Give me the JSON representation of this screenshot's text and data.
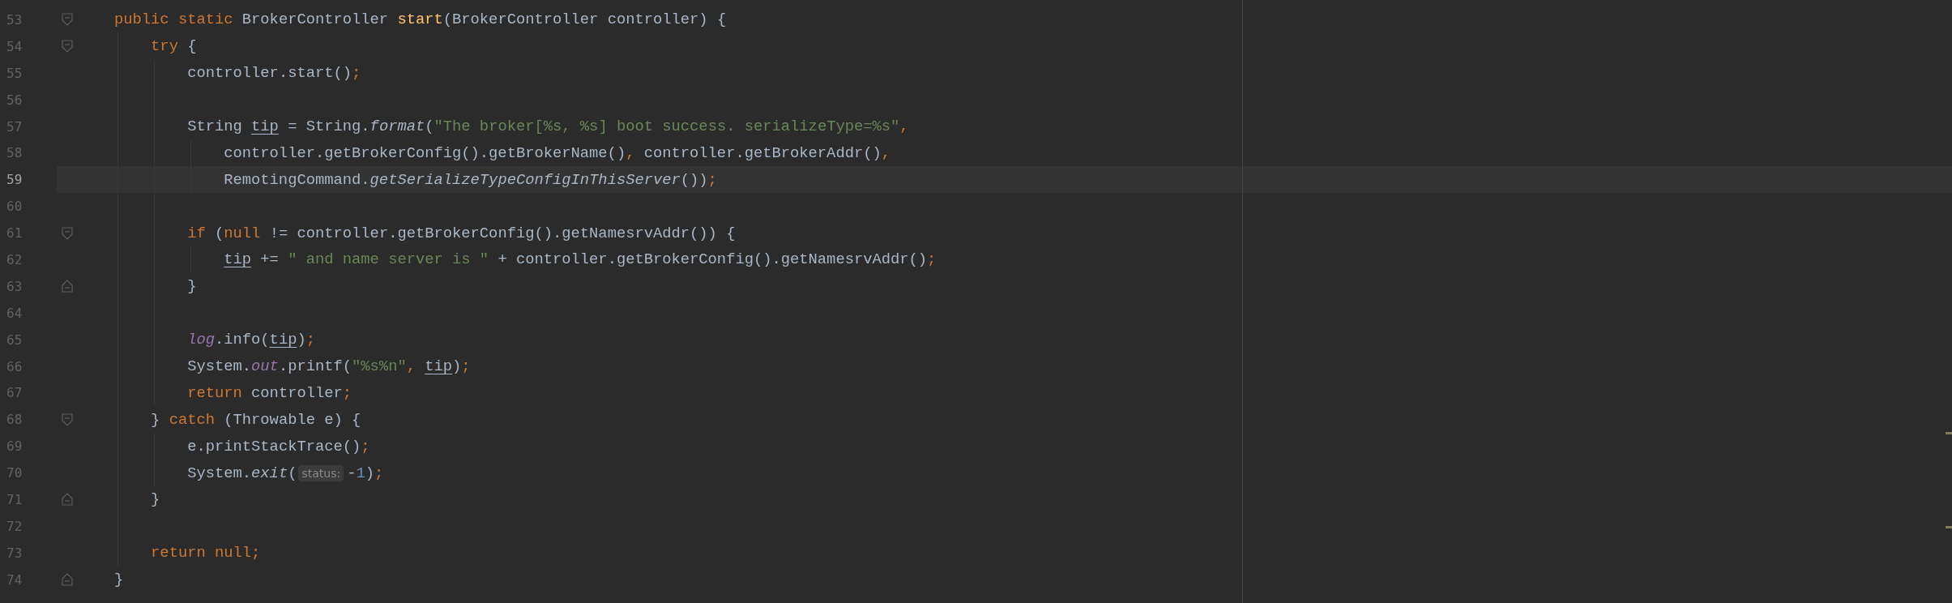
{
  "editor": {
    "lines": [
      {
        "number": "53",
        "current": false,
        "fold_start": true,
        "fold_end": false,
        "tokens": [
          {
            "kind": "keyword",
            "text": "    public static"
          },
          {
            "kind": "text",
            "text": " BrokerController "
          },
          {
            "kind": "declaration",
            "text": "start"
          },
          {
            "kind": "text",
            "text": "(BrokerController controller) {"
          }
        ]
      },
      {
        "number": "54",
        "current": false,
        "fold_start": true,
        "fold_end": false,
        "tokens": [
          {
            "kind": "keyword",
            "text": "        try"
          },
          {
            "kind": "text",
            "text": " {"
          }
        ]
      },
      {
        "number": "55",
        "current": false,
        "fold_start": false,
        "fold_end": false,
        "tokens": [
          {
            "kind": "text",
            "text": "            controller.start()"
          },
          {
            "kind": "punct",
            "text": ";"
          }
        ]
      },
      {
        "number": "56",
        "current": false,
        "fold_start": false,
        "fold_end": false
      },
      {
        "number": "57",
        "current": false,
        "fold_start": false,
        "fold_end": false,
        "tokens": [
          {
            "kind": "text",
            "text": "            String "
          },
          {
            "kind": "variable",
            "text": "tip"
          },
          {
            "kind": "text",
            "text": " = String."
          },
          {
            "kind": "static_call",
            "text": "format"
          },
          {
            "kind": "text",
            "text": "("
          },
          {
            "kind": "string",
            "text": "\"The broker[%s, %s] boot success. serializeType=%s\""
          },
          {
            "kind": "punct",
            "text": ","
          }
        ]
      },
      {
        "number": "58",
        "current": false,
        "fold_start": false,
        "fold_end": false,
        "tokens": [
          {
            "kind": "text",
            "text": "                controller.getBrokerConfig().getBrokerName()"
          },
          {
            "kind": "punct",
            "text": ","
          },
          {
            "kind": "text",
            "text": " controller.getBrokerAddr()"
          },
          {
            "kind": "punct",
            "text": ","
          }
        ]
      },
      {
        "number": "59",
        "current": true,
        "fold_start": false,
        "fold_end": false,
        "tokens": [
          {
            "kind": "text",
            "text": "                RemotingCommand."
          },
          {
            "kind": "static_call",
            "text": "getSerializeTypeConfigInThisServer"
          },
          {
            "kind": "text",
            "text": "())"
          },
          {
            "kind": "punct",
            "text": ";"
          }
        ]
      },
      {
        "number": "60",
        "current": false,
        "fold_start": false,
        "fold_end": false
      },
      {
        "number": "61",
        "current": false,
        "fold_start": true,
        "fold_end": false,
        "tokens": [
          {
            "kind": "keyword",
            "text": "            if"
          },
          {
            "kind": "text",
            "text": " ("
          },
          {
            "kind": "keyword",
            "text": "null"
          },
          {
            "kind": "text",
            "text": " != controller.getBrokerConfig().getNamesrvAddr()) {"
          }
        ]
      },
      {
        "number": "62",
        "current": false,
        "fold_start": false,
        "fold_end": false,
        "tokens": [
          {
            "kind": "variable",
            "text": "                tip"
          },
          {
            "kind": "text",
            "text": " += "
          },
          {
            "kind": "string",
            "text": "\" and name server is \""
          },
          {
            "kind": "text",
            "text": " + controller.getBrokerConfig().getNamesrvAddr()"
          },
          {
            "kind": "punct",
            "text": ";"
          }
        ]
      },
      {
        "number": "63",
        "current": false,
        "fold_start": false,
        "fold_end": true,
        "tokens": [
          {
            "kind": "text",
            "text": "            }"
          }
        ]
      },
      {
        "number": "64",
        "current": false,
        "fold_start": false,
        "fold_end": false
      },
      {
        "number": "65",
        "current": false,
        "fold_start": false,
        "fold_end": false,
        "tokens": [
          {
            "kind": "static_field",
            "text": "            log"
          },
          {
            "kind": "text",
            "text": ".info("
          },
          {
            "kind": "variable",
            "text": "tip"
          },
          {
            "kind": "text",
            "text": ")"
          },
          {
            "kind": "punct",
            "text": ";"
          }
        ]
      },
      {
        "number": "66",
        "current": false,
        "fold_start": false,
        "fold_end": false,
        "tokens": [
          {
            "kind": "text",
            "text": "            System."
          },
          {
            "kind": "static_field",
            "text": "out"
          },
          {
            "kind": "text",
            "text": ".printf("
          },
          {
            "kind": "string",
            "text": "\"%s%n\""
          },
          {
            "kind": "punct",
            "text": ", "
          },
          {
            "kind": "variable",
            "text": "tip"
          },
          {
            "kind": "text",
            "text": ")"
          },
          {
            "kind": "punct",
            "text": ";"
          }
        ]
      },
      {
        "number": "67",
        "current": false,
        "fold_start": false,
        "fold_end": false,
        "tokens": [
          {
            "kind": "keyword",
            "text": "            return"
          },
          {
            "kind": "text",
            "text": " controller"
          },
          {
            "kind": "punct",
            "text": ";"
          }
        ]
      },
      {
        "number": "68",
        "current": false,
        "fold_start": true,
        "fold_end": false,
        "tokens": [
          {
            "kind": "text",
            "text": "        } "
          },
          {
            "kind": "keyword",
            "text": "catch"
          },
          {
            "kind": "text",
            "text": " (Throwable e) {"
          }
        ]
      },
      {
        "number": "69",
        "current": false,
        "fold_start": false,
        "fold_end": false,
        "tokens": [
          {
            "kind": "text",
            "text": "            e.printStackTrace()"
          },
          {
            "kind": "punct",
            "text": ";"
          }
        ]
      },
      {
        "number": "70",
        "current": false,
        "fold_start": false,
        "fold_end": false,
        "tokens": [
          {
            "kind": "text",
            "text": "            System."
          },
          {
            "kind": "static_call",
            "text": "exit"
          },
          {
            "kind": "text",
            "text": "("
          },
          {
            "kind": "hint",
            "text": "status:"
          },
          {
            "kind": "text",
            "text": "-"
          },
          {
            "kind": "number",
            "text": "1"
          },
          {
            "kind": "text",
            "text": ")"
          },
          {
            "kind": "punct",
            "text": ";"
          }
        ]
      },
      {
        "number": "71",
        "current": false,
        "fold_start": false,
        "fold_end": true,
        "tokens": [
          {
            "kind": "text",
            "text": "        }"
          }
        ]
      },
      {
        "number": "72",
        "current": false,
        "fold_start": false,
        "fold_end": false
      },
      {
        "number": "73",
        "current": false,
        "fold_start": false,
        "fold_end": false,
        "tokens": [
          {
            "kind": "keyword",
            "text": "        return null"
          },
          {
            "kind": "punct",
            "text": ";"
          }
        ]
      },
      {
        "number": "74",
        "current": false,
        "fold_start": false,
        "fold_end": true,
        "tokens": [
          {
            "kind": "text",
            "text": "    }"
          }
        ]
      }
    ]
  }
}
